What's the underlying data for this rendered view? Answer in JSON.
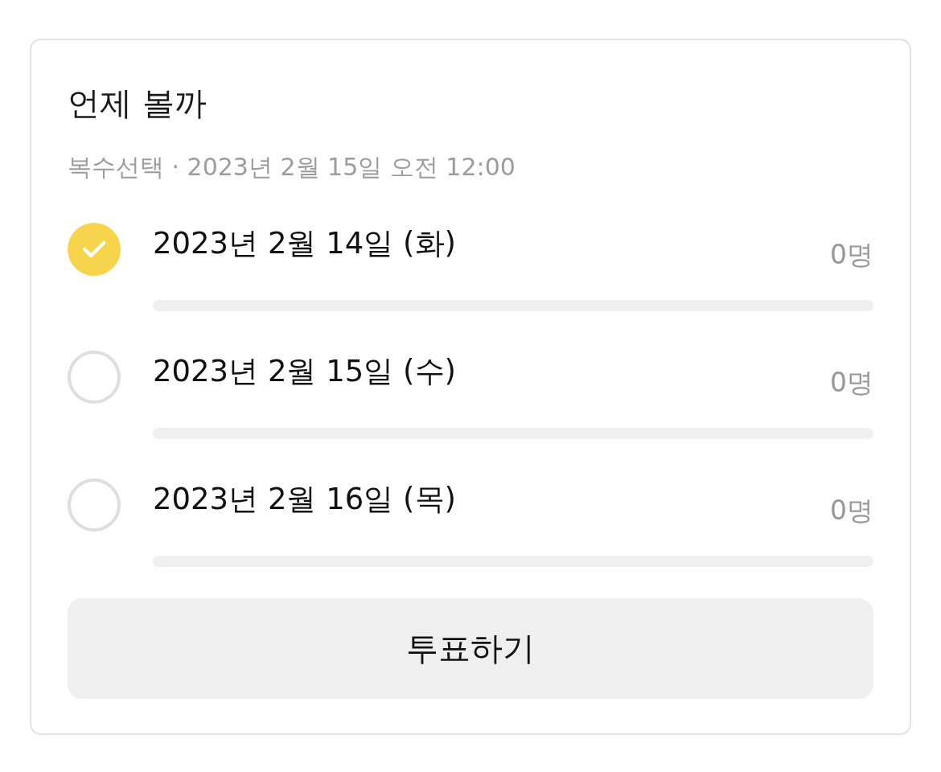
{
  "poll": {
    "title": "언제 볼까",
    "info": "복수선택 · 2023년 2월 15일 오전 12:00"
  },
  "options": [
    {
      "label": "2023년 2월 14일 (화)",
      "count": "0명",
      "selected": true,
      "level": 0
    },
    {
      "label": "2023년 2월 15일 (수)",
      "count": "0명",
      "selected": false,
      "level": 0
    },
    {
      "label": "2023년 2월 16일 (목)",
      "count": "0명",
      "selected": false,
      "level": 0
    }
  ],
  "button": {
    "label": "투표하기"
  }
}
